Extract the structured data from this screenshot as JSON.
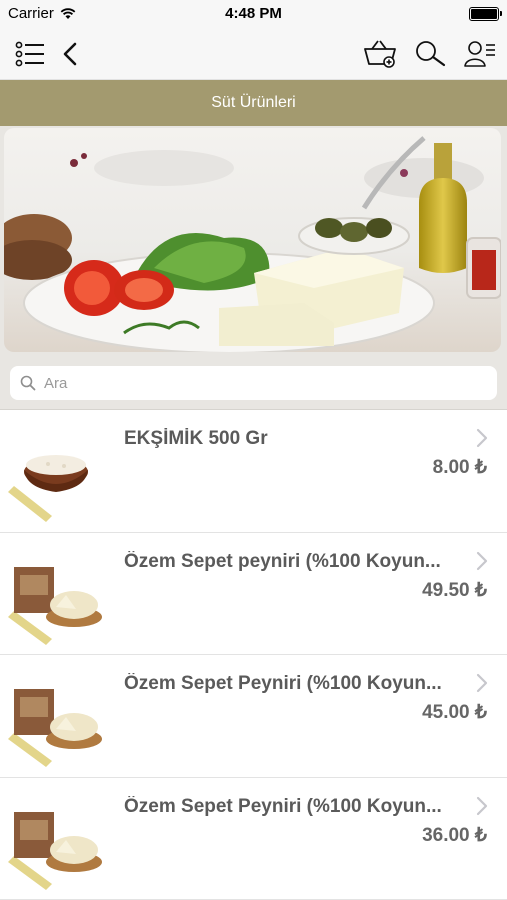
{
  "status_bar": {
    "carrier": "Carrier",
    "time": "4:48 PM"
  },
  "navbar": {
    "icons": [
      "list-menu-icon",
      "back-chevron-icon",
      "basket-icon",
      "search-icon",
      "user-menu-icon"
    ]
  },
  "category": {
    "title": "Süt Ürünleri"
  },
  "banner": {
    "image": "breakfast-cheese-banner"
  },
  "search": {
    "placeholder": "Ara",
    "value": ""
  },
  "products": [
    {
      "name": "EKŞİMİK 500 Gr",
      "price": "8.00 ₺",
      "image": "eksimik-bowl"
    },
    {
      "name": "Özem Sepet peyniri (%100 Koyun...",
      "price": "49.50 ₺",
      "image": "sepet-peyniri-box"
    },
    {
      "name": "Özem Sepet Peyniri (%100 Koyun...",
      "price": "45.00 ₺",
      "image": "sepet-peyniri-box"
    },
    {
      "name": "Özem Sepet Peyniri (%100 Koyun...",
      "price": "36.00 ₺",
      "image": "sepet-peyniri-box"
    }
  ],
  "colors": {
    "category_bar": "#a39a6f",
    "background": "#e8e6e2"
  }
}
